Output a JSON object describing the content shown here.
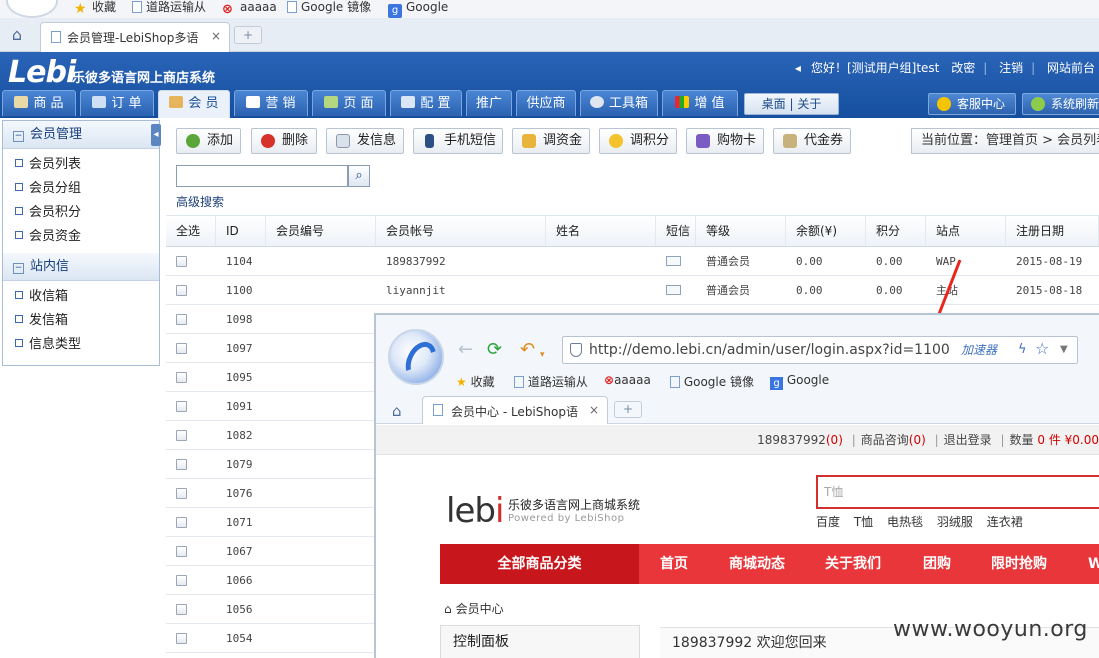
{
  "bookmarks": [
    {
      "label": "收藏",
      "icon": "star-icon"
    },
    {
      "label": "道路运输从",
      "icon": "page-icon"
    },
    {
      "label": "aaaaa",
      "icon": "x-icon"
    },
    {
      "label": "Google 镜像",
      "icon": "page-icon"
    },
    {
      "label": "Google",
      "icon": "google-icon"
    }
  ],
  "browser_tab": {
    "title": "会员管理-LebiShop多语",
    "close": "×",
    "new_tab": "+"
  },
  "app": {
    "logo": "Lebi",
    "title": "乐彼多语言网上商店系统",
    "user": {
      "greeting": "您好！[测试用户组]test",
      "change_password": "改密",
      "logout": "注销",
      "site_front": "网站前台"
    }
  },
  "nav": [
    {
      "label": "商 品",
      "icon": "goods-icon"
    },
    {
      "label": "订 单",
      "icon": "cart-icon"
    },
    {
      "label": "会 员",
      "icon": "users-icon"
    },
    {
      "label": "营 销",
      "icon": "marketing-icon"
    },
    {
      "label": "页 面",
      "icon": "page-icon"
    },
    {
      "label": "配 置",
      "icon": "monitor-icon"
    },
    {
      "label": "推广",
      "icon": ""
    },
    {
      "label": "供应商",
      "icon": ""
    },
    {
      "label": "工具箱",
      "icon": "gear-icon"
    },
    {
      "label": "增 值",
      "icon": "chart-icon"
    }
  ],
  "desk_links": {
    "desktop": "桌面",
    "about": "关于"
  },
  "service_buttons": [
    {
      "label": "客服中心",
      "icon": "bulb-icon"
    },
    {
      "label": "系统刷新",
      "icon": "refresh-icon"
    }
  ],
  "sidebar": {
    "groups": [
      {
        "title": "会员管理",
        "items": [
          "会员列表",
          "会员分组",
          "会员积分",
          "会员资金"
        ]
      },
      {
        "title": "站内信",
        "items": [
          "收信箱",
          "发信箱",
          "信息类型"
        ]
      }
    ]
  },
  "toolbar": {
    "buttons": [
      {
        "label": "添加",
        "icon": "add-icon"
      },
      {
        "label": "删除",
        "icon": "delete-icon"
      },
      {
        "label": "发信息",
        "icon": "mail-icon"
      },
      {
        "label": "手机短信",
        "icon": "phone-icon"
      },
      {
        "label": "调资金",
        "icon": "coins-icon"
      },
      {
        "label": "调积分",
        "icon": "star-icon"
      },
      {
        "label": "购物卡",
        "icon": "card-icon"
      },
      {
        "label": "代金券",
        "icon": "voucher-icon"
      }
    ],
    "location": "当前位置：管理首页 > 会员列表"
  },
  "search": {
    "value": "",
    "placeholder": "",
    "advanced": "高级搜索"
  },
  "table": {
    "columns": [
      "全选",
      "ID",
      "会员编号",
      "会员帐号",
      "姓名",
      "短信",
      "等级",
      "余额(¥)",
      "积分",
      "站点",
      "注册日期"
    ],
    "rows": [
      {
        "id": "1104",
        "account": "189837992",
        "level": "普通会员",
        "balance": "0.00",
        "points": "0.00",
        "site": "WAP",
        "date": "2015-08-19"
      },
      {
        "id": "1100",
        "account": "liyannjit",
        "level": "普通会员",
        "balance": "0.00",
        "points": "0.00",
        "site": "主站",
        "date": "2015-08-18"
      },
      {
        "id": "1098"
      },
      {
        "id": "1097"
      },
      {
        "id": "1095"
      },
      {
        "id": "1091"
      },
      {
        "id": "1082"
      },
      {
        "id": "1079"
      },
      {
        "id": "1076"
      },
      {
        "id": "1071"
      },
      {
        "id": "1067"
      },
      {
        "id": "1066"
      },
      {
        "id": "1056"
      },
      {
        "id": "1054"
      }
    ]
  },
  "overlay": {
    "url": "http://demo.lebi.cn/admin/user/login.aspx?id=1100",
    "accelerator": "加速器",
    "bookmarks": [
      "收藏",
      "道路运输从",
      "aaaaa",
      "Google 镜像",
      "Google"
    ],
    "tab_title": "会员中心 - LebiShop语",
    "shop": {
      "user": "189837992",
      "user_count": "(0)",
      "inquiry": "商品咨询",
      "inquiry_count": "(0)",
      "logout": "退出登录",
      "qty_label": "数量",
      "qty": "0 件 ¥0.00",
      "logo_text": "lebi",
      "logo_title": "乐彼多语言网上商城系统",
      "logo_sub": "Powered by LebiShop",
      "search_placeholder": "T恤",
      "hot_words": [
        "百度",
        "T恤",
        "电热毯",
        "羽绒服",
        "连衣裙"
      ],
      "nav_all": "全部商品分类",
      "nav": [
        "首页",
        "商城动态",
        "关于我们",
        "团购",
        "限时抢购",
        "W"
      ],
      "breadcrumb": "会员中心",
      "panel": "控制面板",
      "welcome": "189837992 欢迎您回来"
    }
  },
  "watermark": "www.wooyun.org",
  "colors": {
    "header_blue": "#1f5aa8",
    "shop_red": "#e8363a",
    "arrow_red": "#e8241c"
  }
}
